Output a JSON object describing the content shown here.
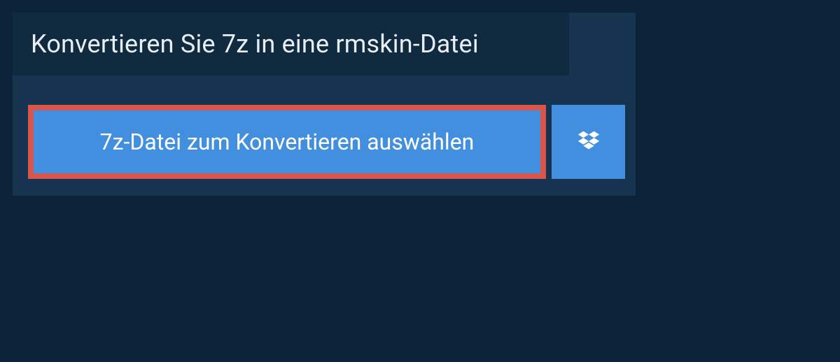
{
  "header": {
    "title": "Konvertieren Sie 7z in eine rmskin-Datei"
  },
  "actions": {
    "select_file_label": "7z-Datei zum Konvertieren auswählen"
  }
}
